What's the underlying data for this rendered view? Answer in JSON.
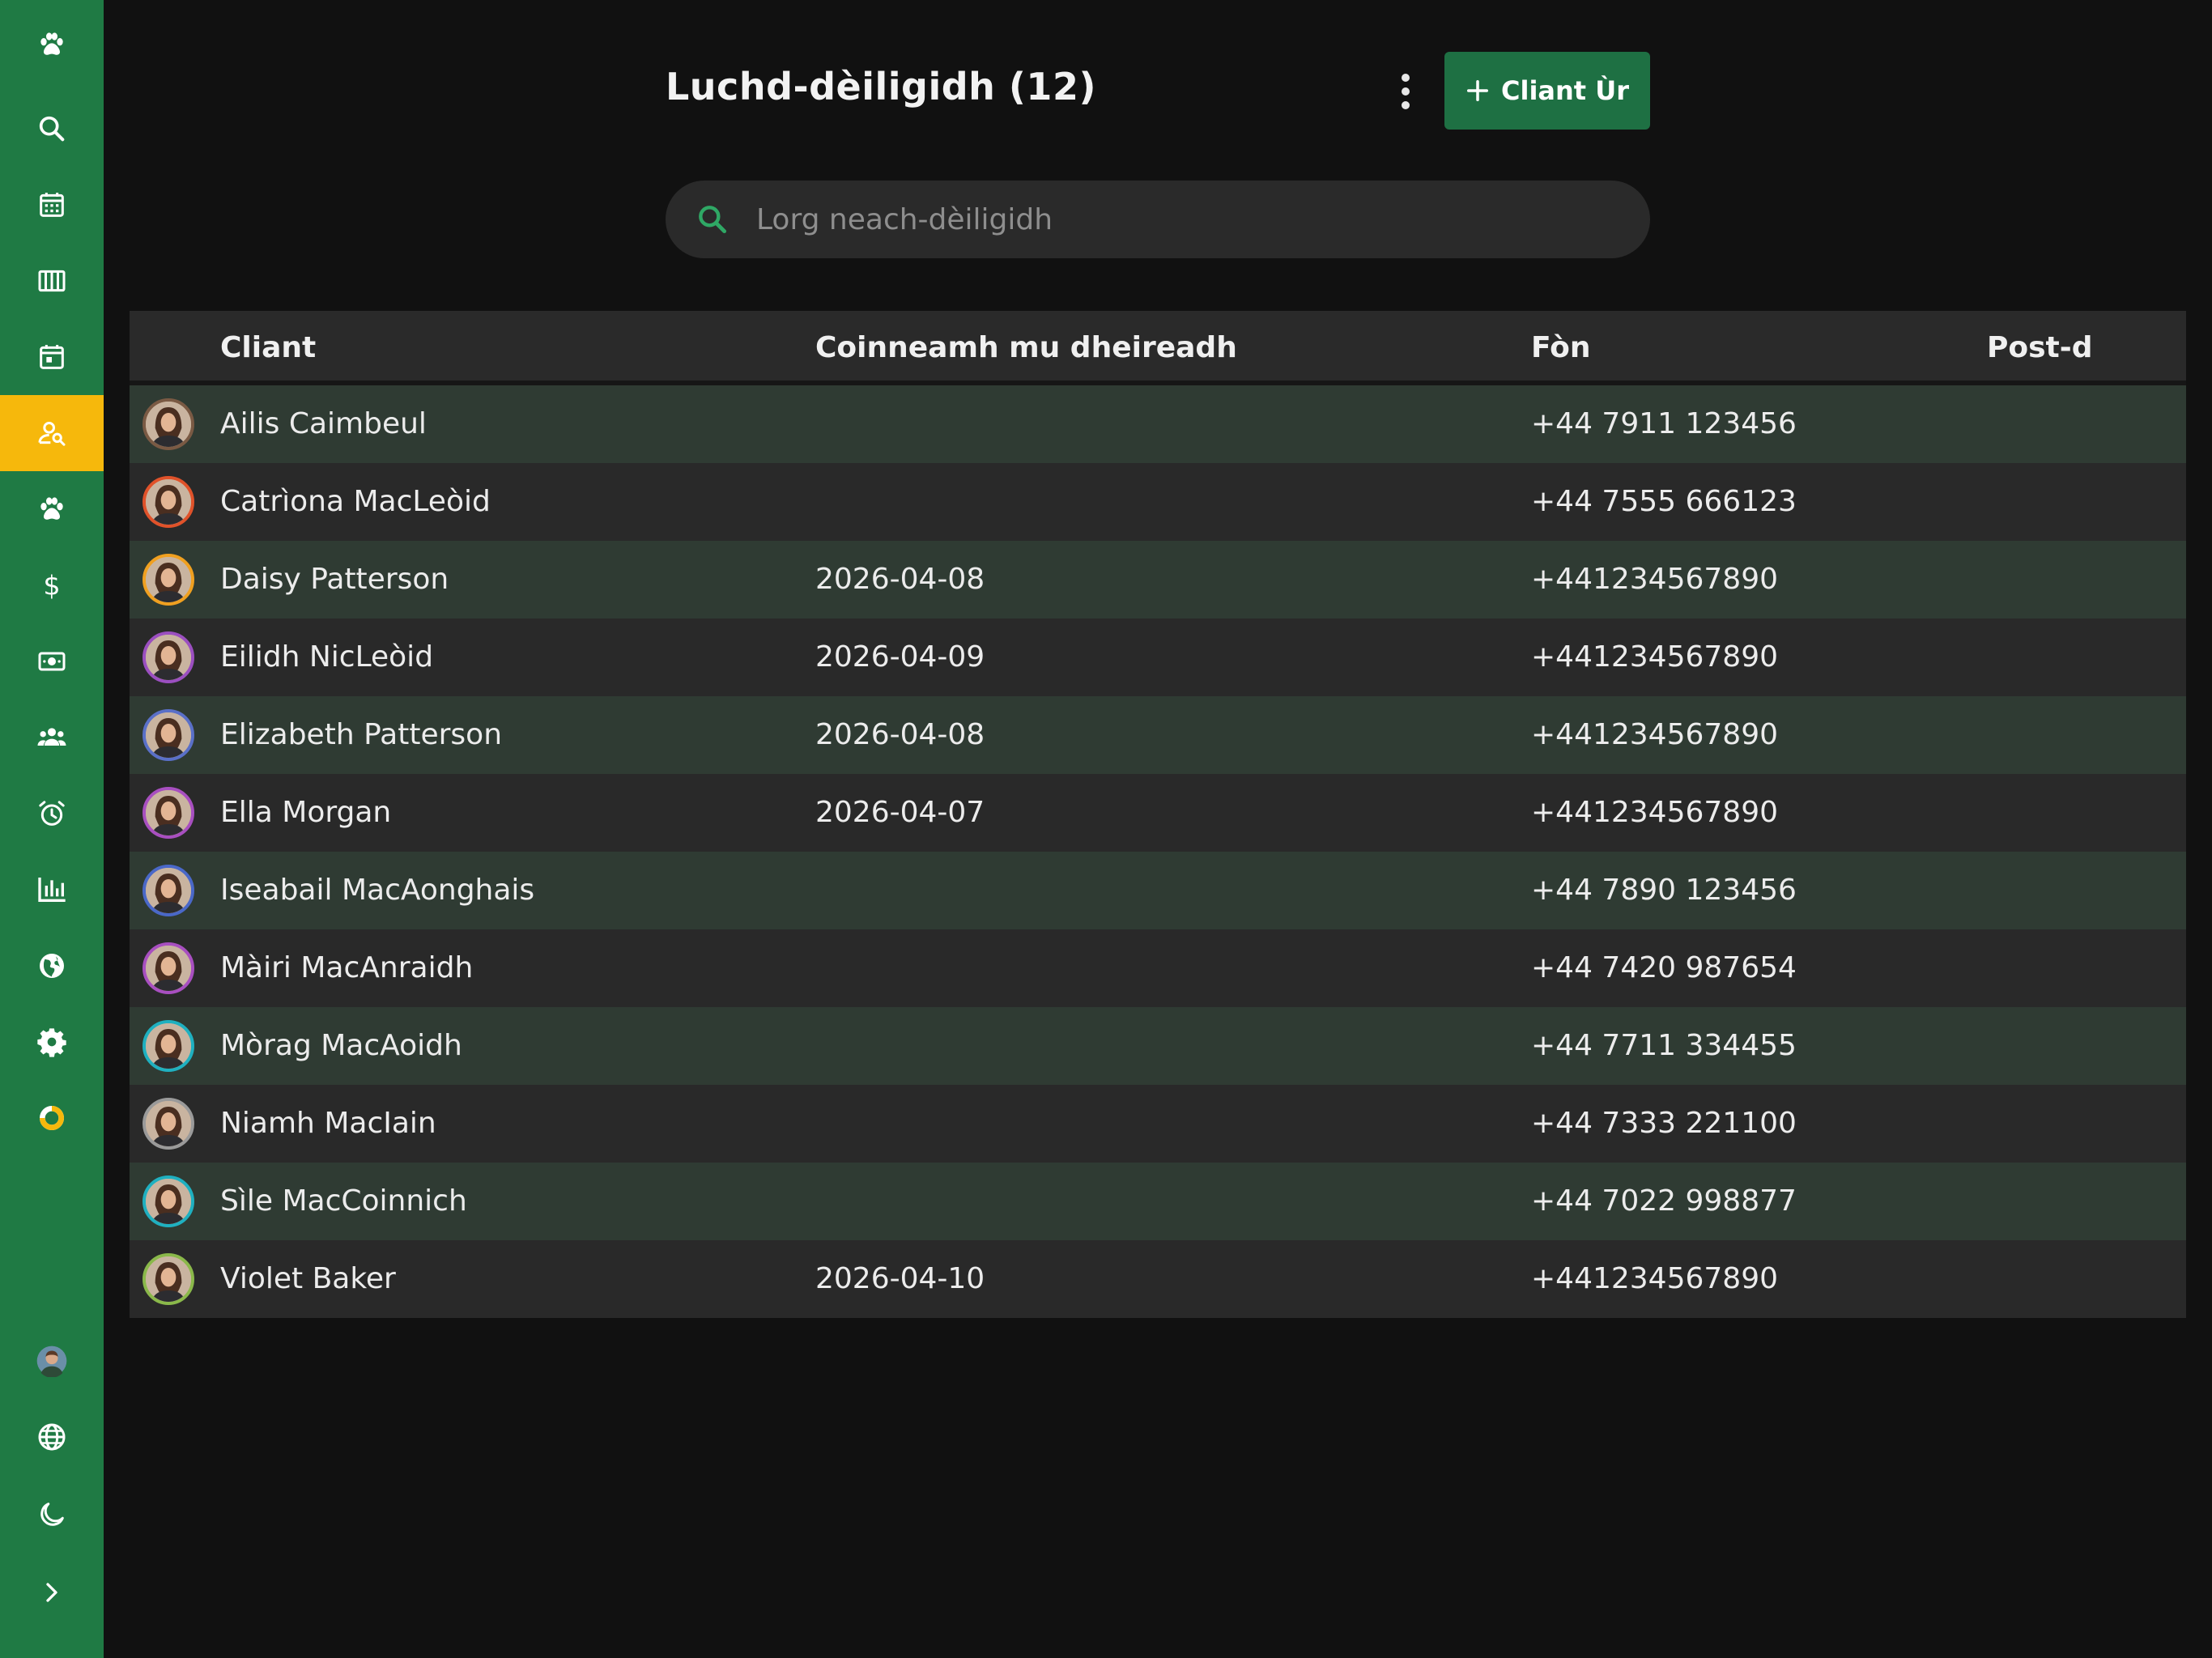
{
  "sidebar": {
    "items": [
      {
        "icon": "paw-icon",
        "name": "sidebar-logo"
      },
      {
        "icon": "search-icon",
        "name": "sidebar-item-search"
      },
      {
        "icon": "calendar-icon",
        "name": "sidebar-item-calendar"
      },
      {
        "icon": "columns-icon",
        "name": "sidebar-item-board"
      },
      {
        "icon": "calendar-day-icon",
        "name": "sidebar-item-appointments"
      },
      {
        "icon": "person-search-icon",
        "name": "sidebar-item-clients",
        "active": true
      },
      {
        "icon": "paw-icon",
        "name": "sidebar-item-pets"
      },
      {
        "icon": "dollar-icon",
        "name": "sidebar-item-pricing"
      },
      {
        "icon": "cash-icon",
        "name": "sidebar-item-payments"
      },
      {
        "icon": "users-icon",
        "name": "sidebar-item-team"
      },
      {
        "icon": "alarm-icon",
        "name": "sidebar-item-reminders"
      },
      {
        "icon": "bar-chart-icon",
        "name": "sidebar-item-reports"
      },
      {
        "icon": "globe-icon",
        "name": "sidebar-item-website"
      },
      {
        "icon": "gear-icon",
        "name": "sidebar-item-settings"
      },
      {
        "icon": "progress-ring-icon",
        "name": "sidebar-item-progress"
      }
    ],
    "bottom": [
      {
        "icon": "user-avatar-icon",
        "name": "sidebar-profile"
      },
      {
        "icon": "globe-language-icon",
        "name": "sidebar-language"
      },
      {
        "icon": "moon-icon",
        "name": "sidebar-theme-toggle"
      },
      {
        "icon": "chevron-right-icon",
        "name": "sidebar-expand"
      }
    ],
    "colors": {
      "background": "#1f7a44",
      "active": "#f6b80c"
    }
  },
  "header": {
    "title": "Luchd-dèiligidh (12)",
    "new_button_label": "Cliant Ùr"
  },
  "search": {
    "placeholder": "Lorg neach-dèiligidh"
  },
  "table": {
    "columns": {
      "client": "Cliant",
      "last_appointment": "Coinneamh mu dheireadh",
      "phone": "Fòn",
      "email": "Post-d"
    },
    "rows": [
      {
        "name": "Ailis Caimbeul",
        "last": "",
        "phone": "+44 7911 123456",
        "email": "",
        "ring": "#7a5a44"
      },
      {
        "name": "Catrìona MacLeòid",
        "last": "",
        "phone": "+44 7555 666123",
        "email": "",
        "ring": "#e0522a"
      },
      {
        "name": "Daisy Patterson",
        "last": "2026-04-08",
        "phone": "+441234567890",
        "email": "",
        "ring": "#f0a020"
      },
      {
        "name": "Eilidh NicLeòid",
        "last": "2026-04-09",
        "phone": "+441234567890",
        "email": "",
        "ring": "#9b4fc0"
      },
      {
        "name": "Elizabeth Patterson",
        "last": "2026-04-08",
        "phone": "+441234567890",
        "email": "",
        "ring": "#5a70c8"
      },
      {
        "name": "Ella Morgan",
        "last": "2026-04-07",
        "phone": "+441234567890",
        "email": "",
        "ring": "#a84fc0"
      },
      {
        "name": "Iseabail MacAonghais",
        "last": "",
        "phone": "+44 7890 123456",
        "email": "",
        "ring": "#4a68c8"
      },
      {
        "name": "Màiri MacAnraidh",
        "last": "",
        "phone": "+44 7420 987654",
        "email": "",
        "ring": "#a84fc0"
      },
      {
        "name": "Mòrag MacAoidh",
        "last": "",
        "phone": "+44 7711 334455",
        "email": "",
        "ring": "#1fb0c0"
      },
      {
        "name": "Niamh MacIain",
        "last": "",
        "phone": "+44 7333 221100",
        "email": "",
        "ring": "#9a9a9a"
      },
      {
        "name": "Sìle MacCoinnich",
        "last": "",
        "phone": "+44 7022 998877",
        "email": "",
        "ring": "#1fb0c0"
      },
      {
        "name": "Violet Baker",
        "last": "2026-04-10",
        "phone": "+441234567890",
        "email": "",
        "ring": "#8ab84a"
      }
    ]
  }
}
